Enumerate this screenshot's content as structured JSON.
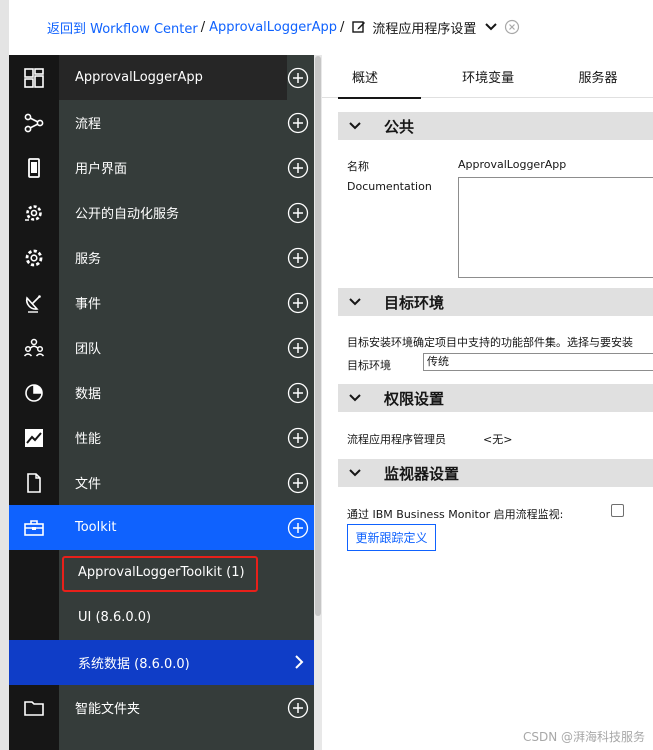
{
  "breadcrumb": {
    "back_link": "返回到 Workflow Center",
    "app_link": "ApprovalLoggerApp",
    "separator": "/",
    "current": "流程应用程序设置"
  },
  "nav": [
    {
      "label": "ApprovalLoggerApp",
      "icon": "dashboard-icon"
    },
    {
      "label": "流程",
      "icon": "process-flow-icon"
    },
    {
      "label": "用户界面",
      "icon": "mobile-device-icon"
    },
    {
      "label": "公开的自动化服务",
      "icon": "automation-gear-icon"
    },
    {
      "label": "服务",
      "icon": "service-gear-icon"
    },
    {
      "label": "事件",
      "icon": "event-satellite-icon"
    },
    {
      "label": "团队",
      "icon": "team-icon"
    },
    {
      "label": "数据",
      "icon": "data-pie-icon"
    },
    {
      "label": "性能",
      "icon": "performance-chart-icon"
    },
    {
      "label": "文件",
      "icon": "file-icon"
    },
    {
      "label": "Toolkit",
      "icon": "toolbox-icon"
    }
  ],
  "toolkit_items": [
    {
      "label": "ApprovalLoggerToolkit (1)"
    },
    {
      "label": "UI (8.6.0.0)"
    },
    {
      "label": "系统数据 (8.6.0.0)"
    }
  ],
  "smart_folder": {
    "label": "智能文件夹",
    "icon": "folder-icon"
  },
  "tabs": [
    {
      "label": "概述"
    },
    {
      "label": "环境变量"
    },
    {
      "label": "服务器"
    }
  ],
  "sections": {
    "public": {
      "title": "公共",
      "name_label": "名称",
      "name_value": "ApprovalLoggerApp",
      "doc_label": "Documentation"
    },
    "target": {
      "title": "目标环境",
      "description": "目标安装环境确定项目中支持的功能部件集。选择与要安装",
      "env_label": "目标环境",
      "env_value": "传统"
    },
    "permissions": {
      "title": "权限设置",
      "admin_label": "流程应用程序管理员",
      "admin_value": "<无>"
    },
    "monitor": {
      "title": "监视器设置",
      "enable_label": "通过 IBM Business Monitor 启用流程监视:",
      "update_button": "更新跟踪定义"
    }
  },
  "watermark": "CSDN @湃海科技服务",
  "colors": {
    "link_blue": "#0f62fe",
    "active_blue": "#0f62fe",
    "selected_blue": "#0f3dc7",
    "sidebar_dark": "#353c3a",
    "highlight_red": "#e8201a"
  }
}
